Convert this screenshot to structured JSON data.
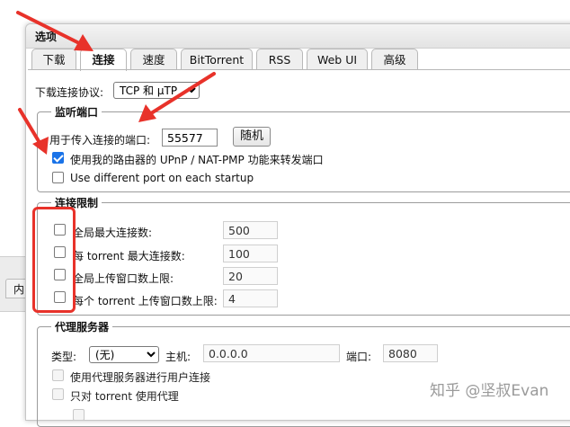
{
  "background": {
    "left_tab_label": "内"
  },
  "dialog": {
    "title": "选项",
    "tabs": [
      {
        "label": "下载",
        "active": false
      },
      {
        "label": "连接",
        "active": true
      },
      {
        "label": "速度",
        "active": false
      },
      {
        "label": "BitTorrent",
        "active": false
      },
      {
        "label": "RSS",
        "active": false
      },
      {
        "label": "Web UI",
        "active": false
      },
      {
        "label": "高级",
        "active": false
      }
    ],
    "protocol": {
      "label": "下载连接协议:",
      "value": "TCP 和 μTP"
    },
    "listening_port": {
      "legend": "监听端口",
      "port_label": "用于传入连接的端口:",
      "port_value": "55577",
      "random_button": "随机",
      "upnp_label": "使用我的路由器的 UPnP / NAT-PMP 功能来转发端口",
      "upnp_checked": true,
      "different_port_label": "Use different port on each startup",
      "different_port_checked": false
    },
    "connection_limits": {
      "legend": "连接限制",
      "items": [
        {
          "label": "全局最大连接数:",
          "value": "500",
          "checked": false
        },
        {
          "label": "每 torrent 最大连接数:",
          "value": "100",
          "checked": false
        },
        {
          "label": "全局上传窗口数上限:",
          "value": "20",
          "checked": false
        },
        {
          "label": "每个 torrent 上传窗口数上限:",
          "value": "4",
          "checked": false
        }
      ]
    },
    "proxy": {
      "legend": "代理服务器",
      "type_label": "类型:",
      "type_value": "(无)",
      "host_label": "主机:",
      "host_value": "0.0.0.0",
      "port_label": "端口:",
      "port_value": "8080",
      "peer_label": "使用代理服务器进行用户连接",
      "torrent_only_label": "只对 torrent 使用代理"
    }
  },
  "annotation_colors": {
    "arrow": "#e8322a",
    "box": "#e8322a"
  },
  "watermark": "知乎 @坚叔Evan"
}
